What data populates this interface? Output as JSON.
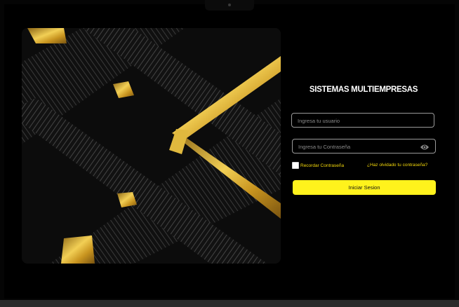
{
  "app": {
    "title": "SISTEMAS MULTIEMPRESAS"
  },
  "login": {
    "username_placeholder": "Ingresa tu usuario",
    "password_placeholder": "Ingresa tu Contraseña",
    "remember_label": "Recordar Contraseña",
    "forgot_label": "¿Haz olvidado tu contraseña?",
    "submit_label": "Iniciar  Sesion",
    "remember_checked": false
  },
  "icons": {
    "password_toggle": "eye-icon"
  },
  "colors": {
    "accent": "#fff21c",
    "link": "#f5d90a",
    "background": "#000000",
    "gold": "#d4a52a"
  }
}
